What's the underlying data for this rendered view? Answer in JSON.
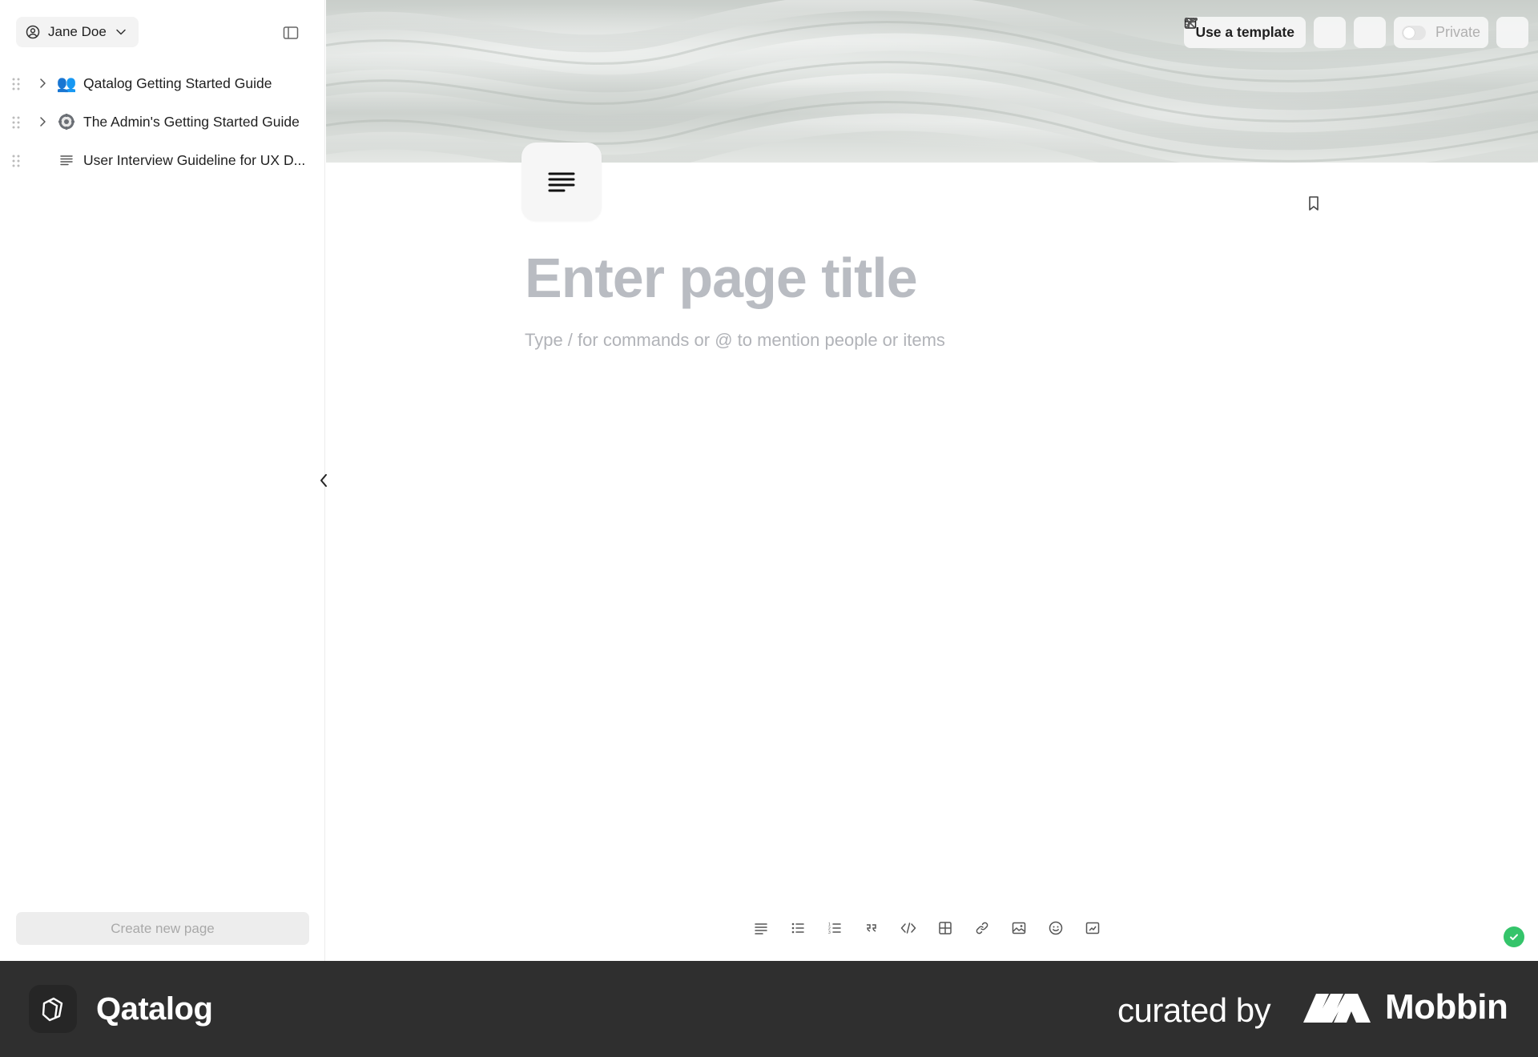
{
  "sidebar": {
    "user_name": "Jane Doe",
    "items": [
      {
        "label": "Qatalog Getting Started Guide",
        "icon": "people-icon",
        "emoji": "👥",
        "has_children": true
      },
      {
        "label": "The Admin's Getting Started Guide",
        "icon": "gear-icon",
        "emoji": "⚙️",
        "has_children": true
      },
      {
        "label": "User Interview Guideline for UX D...",
        "icon": "text-lines-icon",
        "has_children": false
      }
    ],
    "create_button_label": "Create new page"
  },
  "toolbar": {
    "template_label": "Use a template",
    "private_label": "Private",
    "private_enabled": false
  },
  "editor": {
    "title_placeholder": "Enter page title",
    "body_placeholder": "Type / for commands or @ to mention people or items"
  },
  "format_bar": {
    "buttons": [
      "paragraph-icon",
      "bullet-list-icon",
      "numbered-list-icon",
      "quote-icon",
      "code-icon",
      "table-icon",
      "link-icon",
      "image-icon",
      "emoji-icon",
      "embed-icon"
    ]
  },
  "status": {
    "saved_color": "#34c46a"
  },
  "footer": {
    "app_name": "Qatalog",
    "curated_by": "curated by",
    "brand": "Mobbin"
  },
  "colors": {
    "accent_success": "#34c46a",
    "footer_bg": "#2f2f2f"
  }
}
